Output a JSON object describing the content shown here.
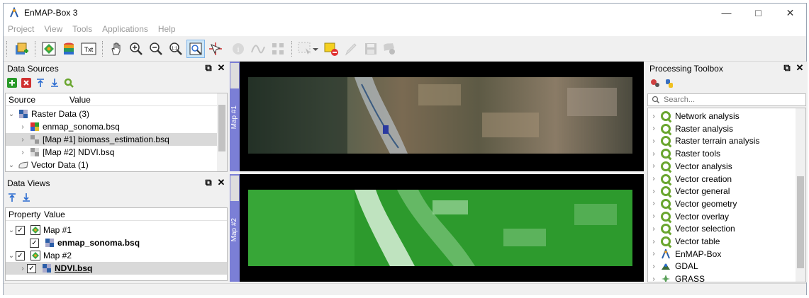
{
  "window": {
    "title": "EnMAP-Box 3",
    "controls": [
      "minimize",
      "maximize",
      "close"
    ]
  },
  "menu": [
    "Project",
    "View",
    "Tools",
    "Applications",
    "Help"
  ],
  "toolbar_icons": [
    "add-data-icon",
    "open-map-icon",
    "open-speclib-icon",
    "open-text-icon",
    "pan-icon",
    "zoom-in-icon",
    "zoom-out-icon",
    "zoom-native-icon",
    "zoom-full-icon",
    "crosshair-icon",
    "identify-icon",
    "spectral-profile-icon",
    "location-icon",
    "select-feature-icon",
    "deselect-icon",
    "edit-icon",
    "save-edits-icon",
    "add-feature-icon"
  ],
  "data_sources": {
    "title": "Data Sources",
    "columns": [
      "Source",
      "Value"
    ],
    "raster_group": "Raster Data (3)",
    "rasters": [
      "enmap_sonoma.bsq",
      "[Map #1] biomass_estimation.bsq",
      "[Map #2] NDVI.bsq"
    ],
    "vector_group": "Vector Data (1)"
  },
  "data_views": {
    "title": "Data Views",
    "columns": [
      "Property",
      "Value"
    ],
    "map1": "Map #1",
    "map1_layer": "enmap_sonoma.bsq",
    "map2": "Map #2",
    "map2_layer": "NDVI.bsq"
  },
  "maps": {
    "map1_label": "Map #1",
    "map2_label": "Map #2"
  },
  "processing": {
    "title": "Processing Toolbox",
    "search_placeholder": "Search...",
    "items": [
      "Network analysis",
      "Raster analysis",
      "Raster terrain analysis",
      "Raster tools",
      "Vector analysis",
      "Vector creation",
      "Vector general",
      "Vector geometry",
      "Vector overlay",
      "Vector selection",
      "Vector table",
      "EnMAP-Box",
      "GDAL",
      "GRASS"
    ]
  }
}
